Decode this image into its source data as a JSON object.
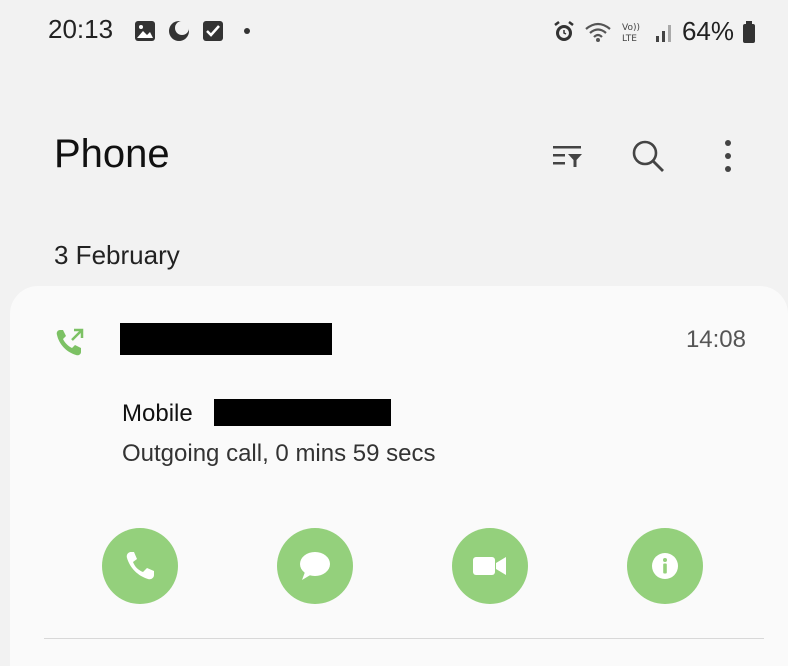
{
  "status_bar": {
    "time": "20:13",
    "battery": "64%",
    "left_icons": [
      "gallery-icon",
      "moon-icon",
      "checkbox-icon",
      "dot-icon"
    ],
    "right_icons": [
      "alarm-icon",
      "wifi-icon",
      "volte-icon",
      "signal-icon",
      "battery-icon"
    ]
  },
  "header": {
    "title": "Phone",
    "actions": [
      "filter-icon",
      "search-icon",
      "more-options-icon"
    ]
  },
  "call_log": {
    "date": "3 February",
    "entry": {
      "time": "14:08",
      "number_type": "Mobile",
      "detail": "Outgoing call, 0 mins 59 secs",
      "call_type_icon": "outgoing-call-icon"
    },
    "actions": [
      "call-icon",
      "message-icon",
      "video-call-icon",
      "info-icon"
    ]
  },
  "colors": {
    "accent_green": "#94d07c",
    "background": "#f2f2f2",
    "card": "#fafafa"
  }
}
